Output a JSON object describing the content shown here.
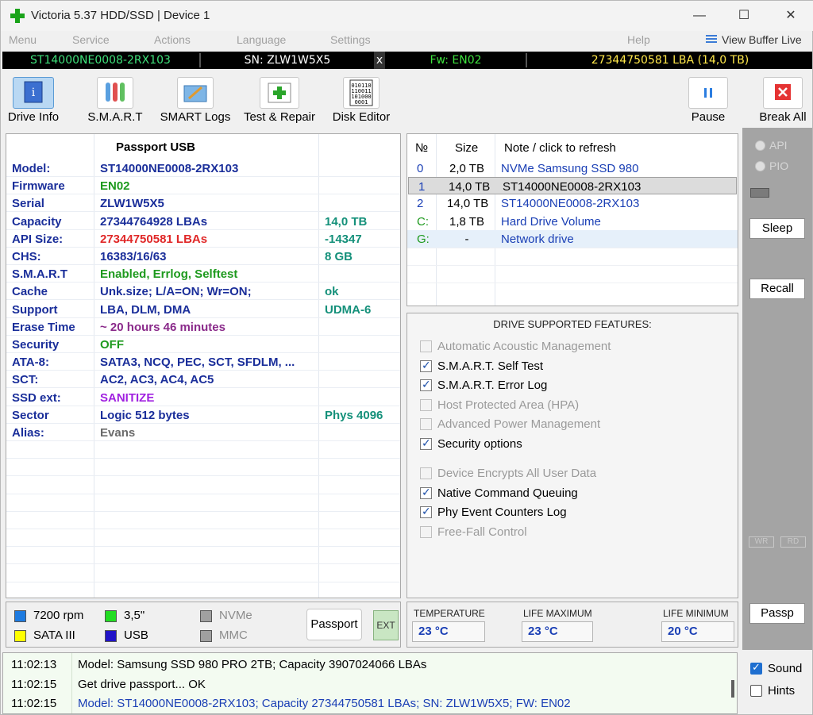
{
  "title": "Victoria 5.37 HDD/SSD | Device 1",
  "window_controls": {
    "minimize": "—",
    "maximize": "☐",
    "close": "✕"
  },
  "menu": [
    "Menu",
    "Service",
    "Actions",
    "Language",
    "Settings",
    "Help"
  ],
  "view_buffer": "View Buffer Live",
  "strip": {
    "model": "ST14000NE0008-2RX103",
    "serial": "SN: ZLW1W5X5",
    "close": "x",
    "firmware": "Fw: EN02",
    "lba": "27344750581 LBA (14,0 TB)"
  },
  "toolbar": {
    "drive_info": "Drive Info",
    "smart": "S.M.A.R.T",
    "smart_logs": "SMART Logs",
    "test_repair": "Test & Repair",
    "disk_editor": "Disk Editor",
    "pause": "Pause",
    "break_all": "Break All"
  },
  "info": {
    "header": "Passport USB",
    "rows": [
      {
        "k": "Model:",
        "v": "ST14000NE0008-2RX103",
        "x": ""
      },
      {
        "k": "Firmware",
        "v": "EN02",
        "x": ""
      },
      {
        "k": "Serial",
        "v": "ZLW1W5X5",
        "x": ""
      },
      {
        "k": "Capacity",
        "v": "27344764928 LBAs",
        "x": "14,0 TB"
      },
      {
        "k": "API Size:",
        "v": "27344750581 LBAs",
        "x": "-14347"
      },
      {
        "k": "CHS:",
        "v": "16383/16/63",
        "x": "8 GB"
      },
      {
        "k": "S.M.A.R.T",
        "v": "Enabled, Errlog, Selftest",
        "x": ""
      },
      {
        "k": "Cache",
        "v": "Unk.size; L/A=ON; Wr=ON;",
        "x": "ok"
      },
      {
        "k": "Support",
        "v": "LBA, DLM, DMA",
        "x": "UDMA-6"
      },
      {
        "k": "Erase Time",
        "v": "~ 20 hours 46 minutes",
        "x": ""
      },
      {
        "k": "Security",
        "v": "OFF",
        "x": ""
      },
      {
        "k": "ATA-8:",
        "v": "SATA3, NCQ, PEC, SCT, SFDLM, ...",
        "x": ""
      },
      {
        "k": "SCT:",
        "v": "AC2, AC3, AC4, AC5",
        "x": ""
      },
      {
        "k": "SSD ext:",
        "v": "SANITIZE",
        "x": ""
      },
      {
        "k": "Sector",
        "v": "Logic 512 bytes",
        "x": "Phys 4096"
      },
      {
        "k": "Alias:",
        "v": "Evans",
        "x": ""
      }
    ]
  },
  "drives": {
    "headers": {
      "no": "№",
      "size": "Size",
      "note": "Note / click to refresh"
    },
    "rows": [
      {
        "no": "0",
        "size": "2,0 TB",
        "note": "NVMe    Samsung SSD 980"
      },
      {
        "no": "1",
        "size": "14,0 TB",
        "note": "ST14000NE0008-2RX103"
      },
      {
        "no": "2",
        "size": "14,0 TB",
        "note": "ST14000NE0008-2RX103"
      },
      {
        "no": "C:",
        "size": "1,8 TB",
        "note": "Hard Drive Volume"
      },
      {
        "no": "G:",
        "size": "-",
        "note": "Network drive"
      }
    ]
  },
  "features": {
    "title": "DRIVE SUPPORTED FEATURES:",
    "items": [
      {
        "label": "Automatic Acoustic Management",
        "checked": false,
        "enabled": false
      },
      {
        "label": "S.M.A.R.T. Self Test",
        "checked": true,
        "enabled": true
      },
      {
        "label": "S.M.A.R.T. Error Log",
        "checked": true,
        "enabled": true
      },
      {
        "label": "Host Protected Area (HPA)",
        "checked": false,
        "enabled": false
      },
      {
        "label": "Advanced Power Management",
        "checked": false,
        "enabled": false
      },
      {
        "label": "Security options",
        "checked": true,
        "enabled": true
      },
      {
        "label": "Device Encrypts All User Data",
        "checked": false,
        "enabled": false
      },
      {
        "label": "Native Command Queuing",
        "checked": true,
        "enabled": true
      },
      {
        "label": "Phy Event Counters Log",
        "checked": true,
        "enabled": true
      },
      {
        "label": "Free-Fall Control",
        "checked": false,
        "enabled": false
      }
    ]
  },
  "legend": {
    "rpm": "7200 rpm",
    "form": "3,5\"",
    "nvme": "NVMe",
    "sata": "SATA III",
    "usb": "USB",
    "mmc": "MMC",
    "passport": "Passport",
    "ext": "EXT",
    "colors": {
      "rpm": "#1e7be0",
      "form": "#22dd22",
      "nvme": "#a0a0a0",
      "sata": "#ffff00",
      "usb": "#2214c8",
      "mmc": "#a0a0a0"
    }
  },
  "temps": {
    "temperature_label": "TEMPERATURE",
    "temperature": "23 °C",
    "life_max_label": "LIFE MAXIMUM",
    "life_max": "23 °C",
    "life_min_label": "LIFE MINIMUM",
    "life_min": "20 °C"
  },
  "side": {
    "api": "API",
    "pio": "PIO",
    "sleep": "Sleep",
    "recall": "Recall",
    "wr": "WR",
    "rd": "RD",
    "passp": "Passp"
  },
  "log": [
    {
      "time": "11:02:13",
      "msg": "Model: Samsung SSD 980 PRO 2TB; Capacity 3907024066 LBAs"
    },
    {
      "time": "11:02:15",
      "msg": "Get drive passport... OK"
    },
    {
      "time": "11:02:15",
      "msg": "Model: ST14000NE0008-2RX103; Capacity 27344750581 LBAs; SN: ZLW1W5X5; FW: EN02"
    }
  ],
  "options": {
    "sound": "Sound",
    "hints": "Hints",
    "sound_checked": true,
    "hints_checked": false
  }
}
